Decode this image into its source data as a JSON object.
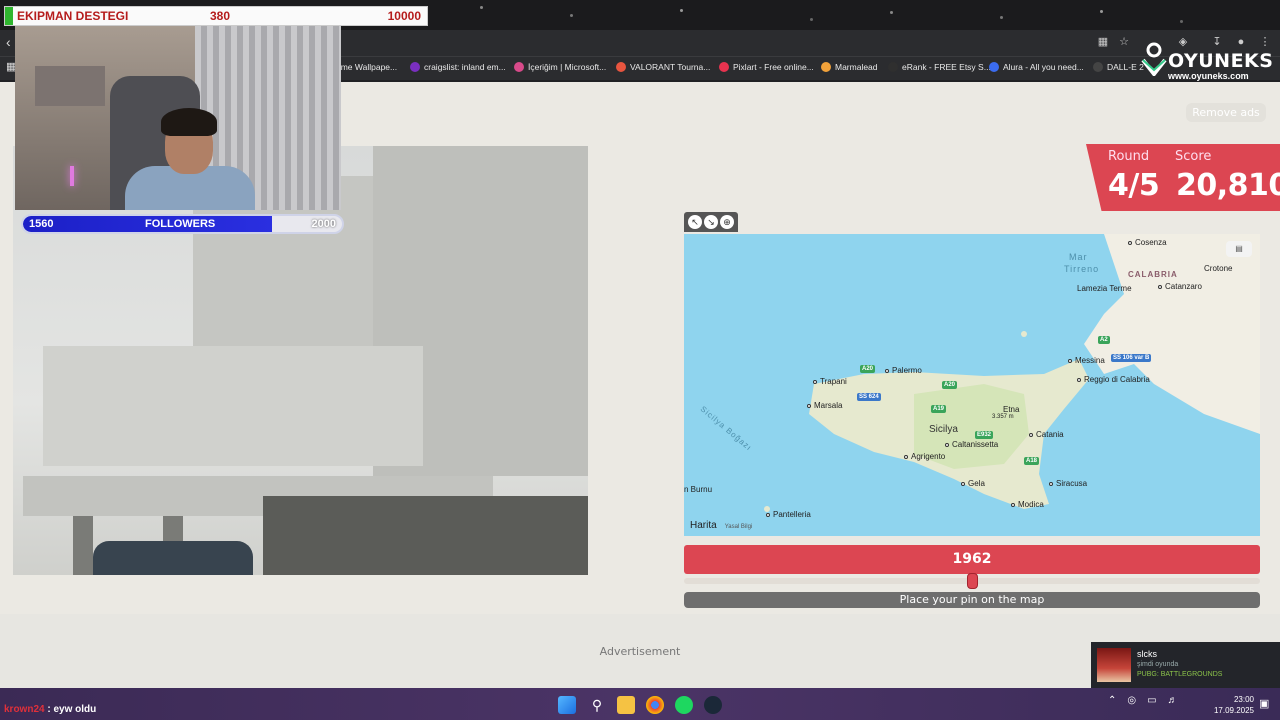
{
  "overlay": {
    "goal_label": "EKIPMAN DESTEGI",
    "goal_current": "380",
    "goal_target": "10000",
    "followers_current": "1560",
    "followers_label": "FOLLOWERS",
    "followers_target": "2000",
    "followers_progress": 0.78
  },
  "bookmarks": [
    {
      "label": "ome Wallpape...",
      "color": "#555555"
    },
    {
      "label": "craigslist: inland em...",
      "color": "#7a2fc0"
    },
    {
      "label": "İçeriğim | Microsoft...",
      "color": "#d84a8a"
    },
    {
      "label": "VALORANT Tourna...",
      "color": "#e8553f"
    },
    {
      "label": "Pixlart - Free online...",
      "color": "#e8334f"
    },
    {
      "label": "Marmalead",
      "color": "#f2a23a"
    },
    {
      "label": "eRank - FREE Etsy S...",
      "color": "#2f2f2f"
    },
    {
      "label": "Alura - All you need...",
      "color": "#3b6cf0"
    },
    {
      "label": "DALL-E 2",
      "color": "#444444"
    }
  ],
  "logo": {
    "name": "OYUNEKS",
    "url": "www.oyuneks.com"
  },
  "game": {
    "remove_ads": "Remove ads",
    "round_label": "Round",
    "round_value": "4/5",
    "score_label": "Score",
    "score_value": "20,810",
    "year": "1962",
    "year_position": 0.5,
    "pin_prompt": "Place your pin on the map",
    "advertisement": "Advertisement"
  },
  "map": {
    "sea_labels": {
      "tirreno_1": "Mar",
      "tirreno_2": "Tirreno",
      "canal": "Sicilya Boğazı"
    },
    "region_labels": {
      "calabria": "CALABRIA",
      "sicilya": "Sicilya"
    },
    "cities": {
      "cosenza": "Cosenza",
      "crotone": "Crotone",
      "lamezia": "Lamezia Terme",
      "catanzaro": "Catanzaro",
      "messina": "Messina",
      "reggio": "Reggio di Calabria",
      "palermo": "Palermo",
      "trapani": "Trapani",
      "marsala": "Marsala",
      "etna": "Etna",
      "etna_elev": "3.357 m",
      "caltanissetta": "Caltanissetta",
      "catania": "Catania",
      "agrigento": "Agrigento",
      "gela": "Gela",
      "siracusa": "Siracusa",
      "modica": "Modica",
      "pantelleria": "Pantelleria",
      "burnu": "n Burnu"
    },
    "roads": {
      "a20a": "A20",
      "a20b": "A20",
      "ss624": "SS 624",
      "a19": "A19",
      "a2": "A2",
      "ss106": "SS 106 var B",
      "e932": "E932",
      "a18": "A18"
    },
    "attribution": "Harita",
    "legal": "Yasal Bilgi"
  },
  "steam": {
    "name": "slcks",
    "status": "şimdi oyunda",
    "game": "PUBG: BATTLEGROUNDS"
  },
  "chat": {
    "user": "krown24",
    "message": ": eyw oldu"
  },
  "clock": {
    "time": "23:00",
    "date": "17.09.2025"
  }
}
